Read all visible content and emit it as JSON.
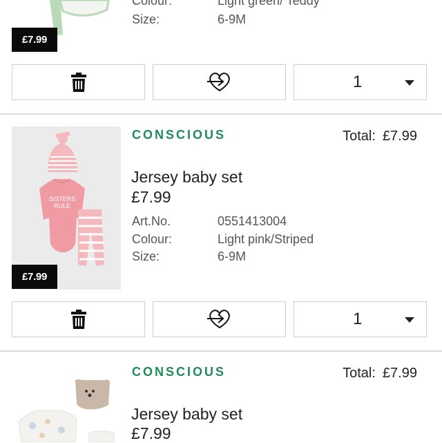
{
  "items": [
    {
      "badge_price": "£7.99",
      "colour_label": "Colour:",
      "colour_value": "Light green/ Teddy",
      "size_label": "Size:",
      "size_value": "6-9M",
      "quantity": "1"
    },
    {
      "tag": "CONSCIOUS",
      "total_label": "Total:",
      "total_value": "£7.99",
      "name": "Jersey baby set",
      "price": "£7.99",
      "artno_label": "Art.No.",
      "artno_value": "0551413004",
      "colour_label": "Colour:",
      "colour_value": "Light pink/Striped",
      "size_label": "Size:",
      "size_value": "6-9M",
      "badge_price": "£7.99",
      "bodysuit_print": "SISTERS RULE",
      "quantity": "1"
    },
    {
      "tag": "CONSCIOUS",
      "total_label": "Total:",
      "total_value": "£7.99",
      "name": "Jersey baby set",
      "price": "£7.99"
    }
  ],
  "icons": {
    "delete": "trash-icon",
    "favorite": "heart-arrow-icon",
    "dropdown": "chevron-down-icon"
  },
  "colors": {
    "conscious_green": "#1f8a5b",
    "badge_bg": "#0a0a0a",
    "divider": "#dcdcdc"
  }
}
